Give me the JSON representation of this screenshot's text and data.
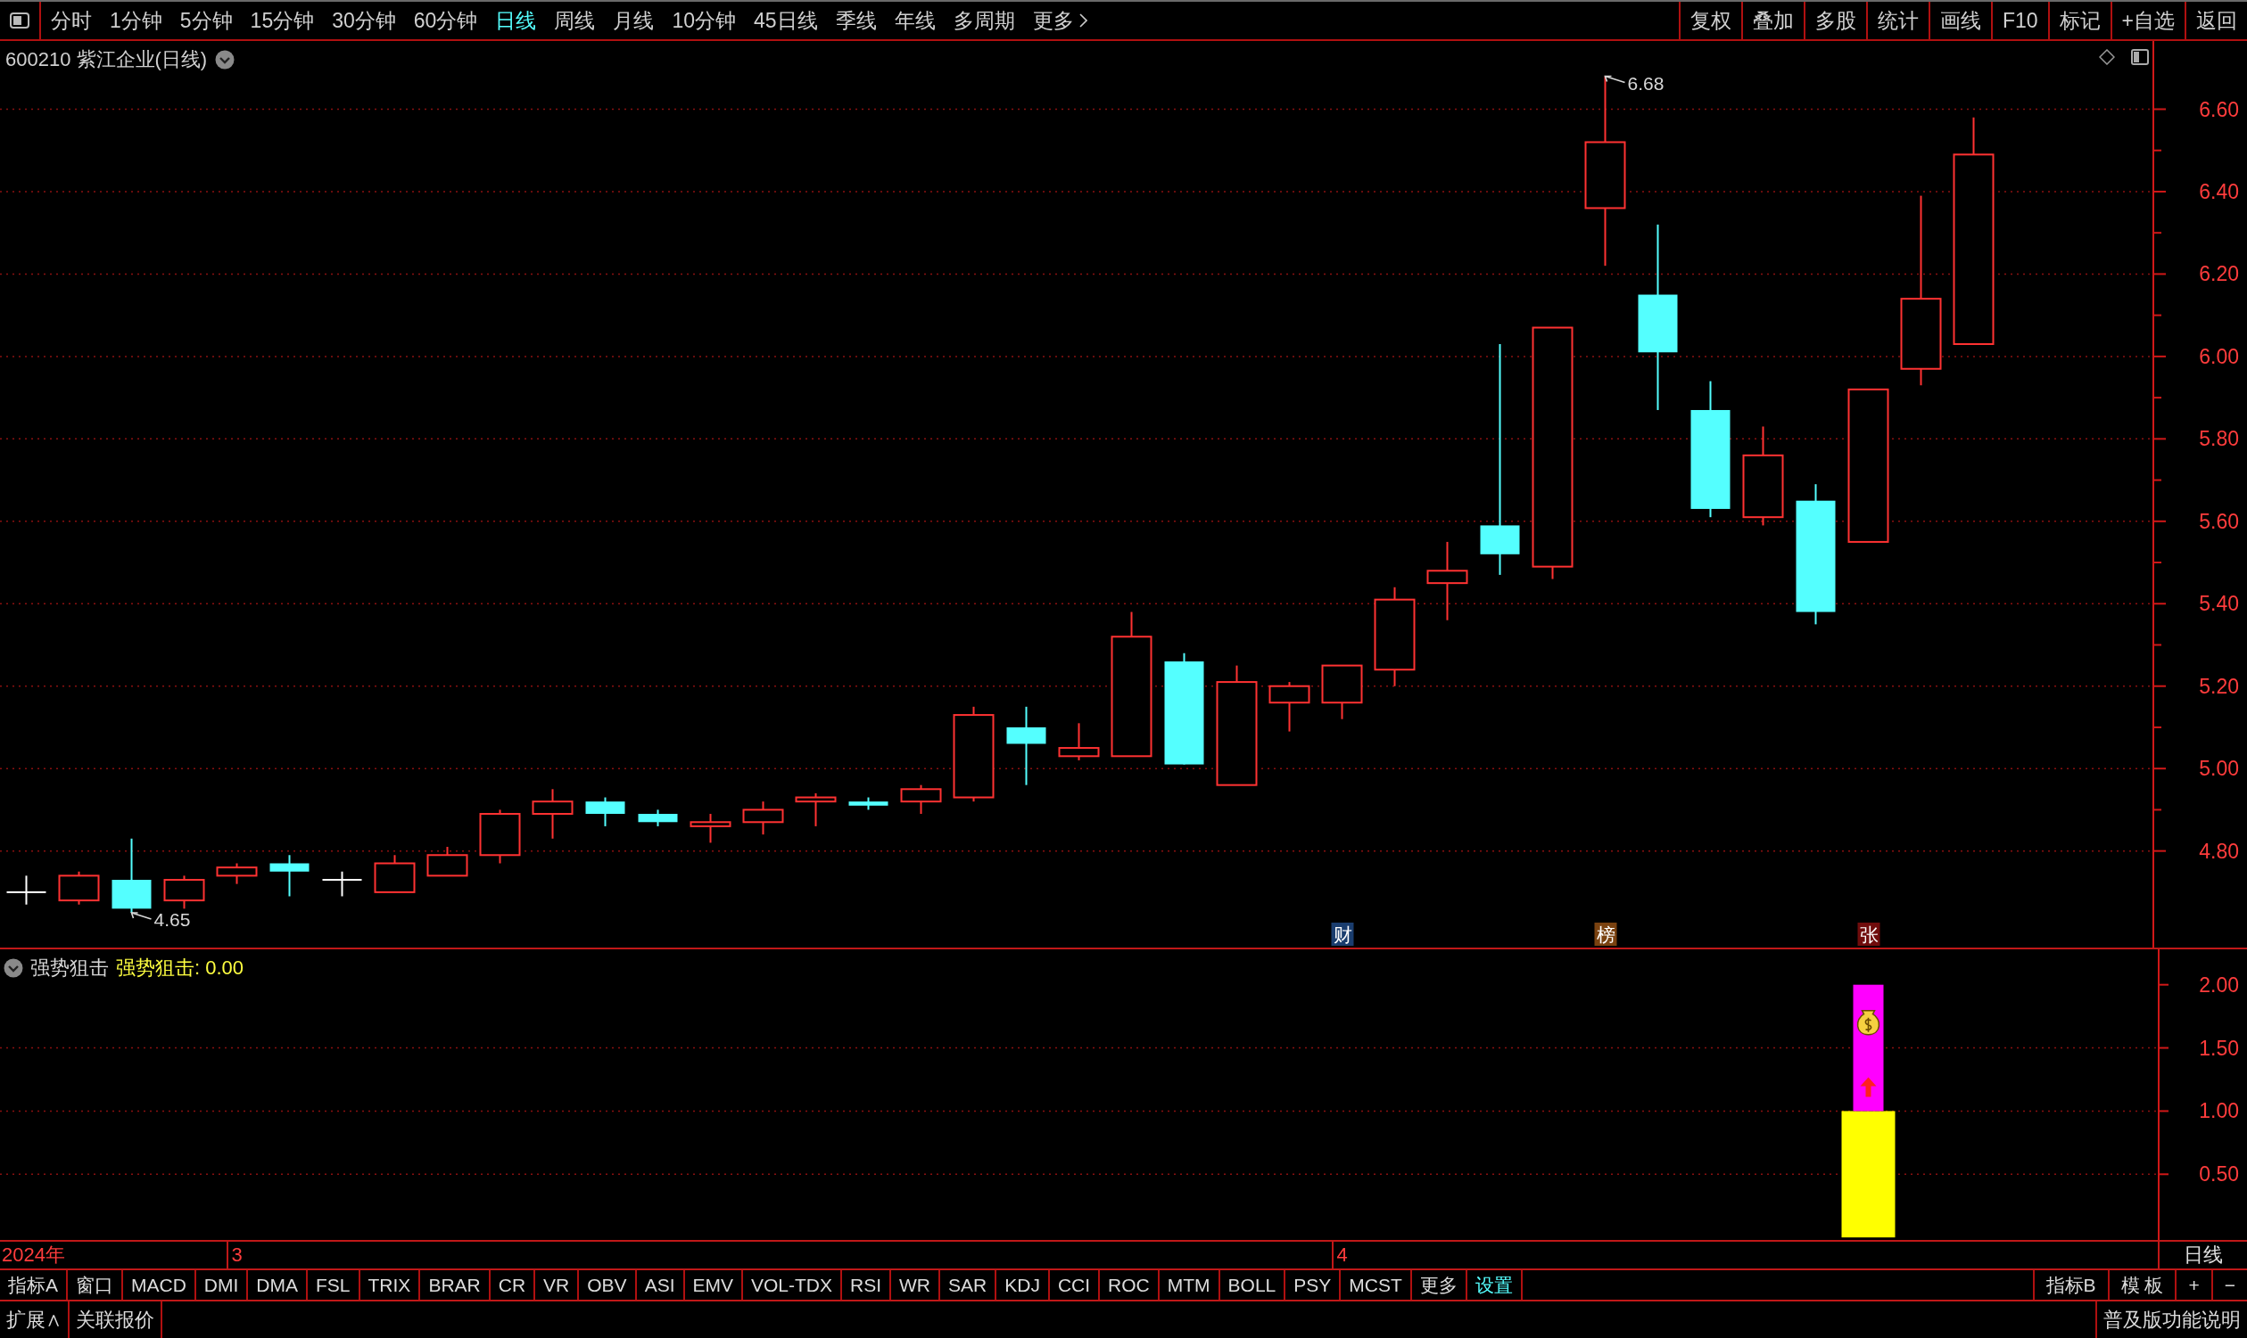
{
  "toolbar": {
    "periods": [
      {
        "label": "分时",
        "selected": false
      },
      {
        "label": "1分钟",
        "selected": false
      },
      {
        "label": "5分钟",
        "selected": false
      },
      {
        "label": "15分钟",
        "selected": false
      },
      {
        "label": "30分钟",
        "selected": false
      },
      {
        "label": "60分钟",
        "selected": false
      },
      {
        "label": "日线",
        "selected": true
      },
      {
        "label": "周线",
        "selected": false
      },
      {
        "label": "月线",
        "selected": false
      },
      {
        "label": "10分钟",
        "selected": false
      },
      {
        "label": "45日线",
        "selected": false
      },
      {
        "label": "季线",
        "selected": false
      },
      {
        "label": "年线",
        "selected": false
      },
      {
        "label": "多周期",
        "selected": false
      }
    ],
    "more": "更多",
    "actions": [
      "复权",
      "叠加",
      "多股",
      "统计",
      "画线",
      "F10",
      "标记",
      "+自选",
      "返回"
    ]
  },
  "chart": {
    "title": "600210 紫江企业(日线)",
    "price_axis": [
      "6.60",
      "6.40",
      "6.20",
      "6.00",
      "5.80",
      "5.60",
      "5.40",
      "5.20",
      "5.00",
      "4.80"
    ],
    "high_label": "6.68",
    "low_label": "4.65",
    "event_markers": [
      {
        "text": "财",
        "color": "#1a3d6e"
      },
      {
        "text": "榜",
        "color": "#7a4210"
      },
      {
        "text": "张",
        "color": "#700c0c"
      }
    ]
  },
  "indicator": {
    "name": "强势狙击",
    "reading": "强势狙击: 0.00",
    "chart_data": {
      "type": "bar",
      "categories": [
        "2024年",
        null,
        null,
        null,
        "3",
        null,
        null,
        null,
        null,
        null,
        null,
        null,
        null,
        null,
        null,
        null,
        null,
        null,
        null,
        null,
        null,
        null,
        null,
        null,
        null,
        "4",
        null,
        null,
        null,
        null,
        null,
        null,
        null,
        null,
        null,
        null,
        null,
        null,
        null,
        null,
        null
      ],
      "stacked": true,
      "series": [
        {
          "color": "#ffff00",
          "values": [
            0,
            0,
            0,
            0,
            0,
            0,
            0,
            0,
            0,
            0,
            0,
            0,
            0,
            0,
            0,
            0,
            0,
            0,
            0,
            0,
            0,
            0,
            0,
            0,
            0,
            0,
            0,
            0,
            0,
            0,
            0,
            0,
            0,
            0,
            0,
            1,
            0,
            0,
            null,
            null,
            null
          ]
        },
        {
          "color": "#ff00ff",
          "values": [
            0,
            0,
            0,
            0,
            0,
            0,
            0,
            0,
            0,
            0,
            0,
            0,
            0,
            0,
            0,
            0,
            0,
            0,
            0,
            0,
            0,
            0,
            0,
            0,
            0,
            0,
            0,
            0,
            0,
            0,
            0,
            0,
            0,
            0,
            0,
            1,
            0,
            0,
            null,
            null,
            null
          ]
        }
      ],
      "ylim": [
        -0.02,
        2.28
      ],
      "yticks": [
        {
          "value": 0.5,
          "label": "0.50"
        },
        {
          "value": 1.0,
          "label": "1.00"
        },
        {
          "value": 1.5,
          "label": "1.50"
        },
        {
          "value": 2.0,
          "label": "2.00"
        }
      ],
      "grid": true
    }
  },
  "period_label": "日线",
  "indicator_tabs": [
    {
      "label": "指标A",
      "kind": "tab"
    },
    {
      "label": "窗口",
      "kind": "tab"
    },
    {
      "label": "MACD",
      "kind": "tab"
    },
    {
      "label": "DMI",
      "kind": "tab"
    },
    {
      "label": "DMA",
      "kind": "tab"
    },
    {
      "label": "FSL",
      "kind": "tab"
    },
    {
      "label": "TRIX",
      "kind": "tab"
    },
    {
      "label": "BRAR",
      "kind": "tab"
    },
    {
      "label": "CR",
      "kind": "tab"
    },
    {
      "label": "VR",
      "kind": "tab"
    },
    {
      "label": "OBV",
      "kind": "tab"
    },
    {
      "label": "ASI",
      "kind": "tab"
    },
    {
      "label": "EMV",
      "kind": "tab"
    },
    {
      "label": "VOL-TDX",
      "kind": "tab"
    },
    {
      "label": "RSI",
      "kind": "tab"
    },
    {
      "label": "WR",
      "kind": "tab"
    },
    {
      "label": "SAR",
      "kind": "tab"
    },
    {
      "label": "KDJ",
      "kind": "tab"
    },
    {
      "label": "CCI",
      "kind": "tab"
    },
    {
      "label": "ROC",
      "kind": "tab"
    },
    {
      "label": "MTM",
      "kind": "tab"
    },
    {
      "label": "BOLL",
      "kind": "tab"
    },
    {
      "label": "PSY",
      "kind": "tab"
    },
    {
      "label": "MCST",
      "kind": "tab"
    },
    {
      "label": "更多",
      "kind": "tab"
    },
    {
      "label": "设置",
      "kind": "settings"
    }
  ],
  "tabs_right": [
    "指标B",
    "模 板",
    "+",
    "−"
  ],
  "status_bar": {
    "left": [
      "扩展∧",
      "关联报价"
    ],
    "right": "普及版功能说明"
  }
}
